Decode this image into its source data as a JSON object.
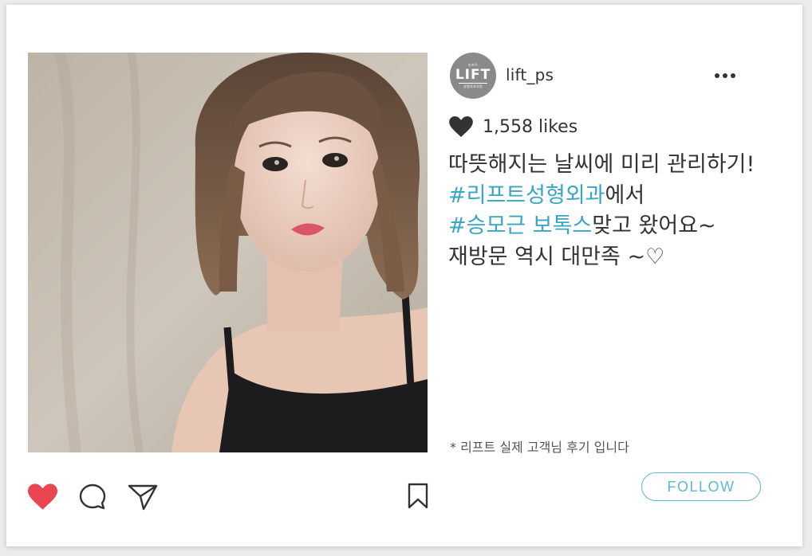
{
  "post": {
    "username": "lift_ps",
    "avatar": {
      "logo": "LIFT",
      "small_text_top": "리프트",
      "small_text_bottom": "성형외과의원"
    },
    "likes": "1,558 likes",
    "caption": {
      "line1": "따뜻해지는 날씨에 미리 관리하기!",
      "line2_hashtag": "#리프트성형외과",
      "line2_rest": "에서",
      "line3_hashtag": "#승모근 보톡스",
      "line3_rest": "맞고 왔어요~",
      "line4": "재방문 역시 대만족 ~♡"
    },
    "note": "* 리프트 실제 고객님 후기 입니다",
    "follow_label": "FOLLOW"
  },
  "colors": {
    "hashtag": "#3aa6c2",
    "liked_heart": "#e8474f",
    "follow_accent": "#5cbad0",
    "text": "#333333"
  },
  "icons": [
    "heart-icon",
    "comment-icon",
    "send-icon",
    "bookmark-icon",
    "more-icon"
  ]
}
